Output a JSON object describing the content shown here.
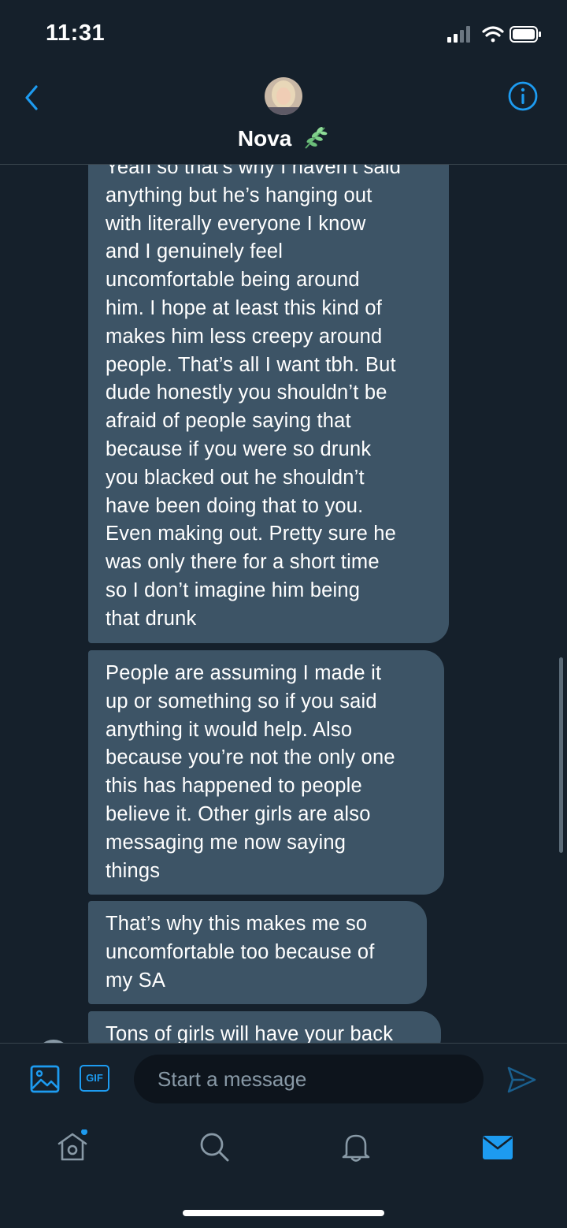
{
  "status_bar": {
    "time": "11:31"
  },
  "header": {
    "contact_name": "Nova"
  },
  "thread": {
    "messages": [
      {
        "lines": [
          "Yeah so that’s why I haven’t said",
          "anything but he’s hanging out",
          "with literally everyone I know",
          "and I genuinely feel",
          "uncomfortable being around",
          "him. I hope at least this kind of",
          "makes him less creepy around",
          "people. That’s all I want tbh. But",
          "dude honestly you shouldn’t be",
          "afraid of people saying that",
          "because if you were so drunk",
          "you blacked out he shouldn’t",
          "have been doing that to you.",
          "Even making out. Pretty sure he",
          "was only there for a short time",
          "so I don’t imagine him being",
          "that drunk"
        ]
      },
      {
        "lines": [
          "People are assuming I made it",
          "up or something so if you said",
          "anything it would help. Also",
          "because you’re not the only one",
          "this has happened to people",
          "believe it. Other girls are also",
          "messaging me now saying",
          "things"
        ]
      },
      {
        "lines": [
          "That’s why this makes me so",
          "uncomfortable too because of",
          "my SA"
        ]
      },
      {
        "lines": [
          "Tons of girls will have your back"
        ]
      }
    ]
  },
  "composer": {
    "gif_label": "GIF",
    "placeholder": "Start a message"
  },
  "colors": {
    "background": "#15202b",
    "bubble": "#3d5466",
    "accent": "#1d9bf0",
    "divider": "#38444d",
    "muted": "#8899a6"
  },
  "icons": {
    "back": "chevron-left-icon",
    "info": "info-icon",
    "leaf": "leaf-icon",
    "media": "image-icon",
    "send": "send-icon",
    "home": "home-icon",
    "search": "search-icon",
    "notifications": "bell-icon",
    "messages": "mail-icon"
  }
}
